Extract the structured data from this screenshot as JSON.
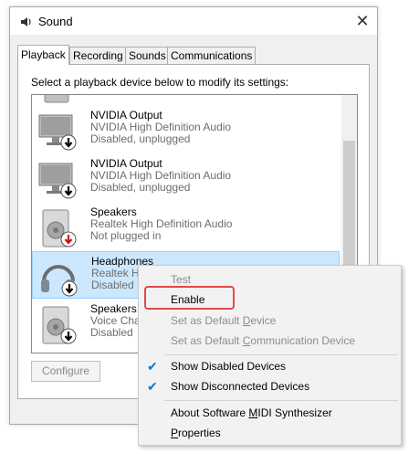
{
  "window": {
    "title": "Sound"
  },
  "tabs": [
    {
      "label": "Playback",
      "active": true
    },
    {
      "label": "Recording",
      "active": false
    },
    {
      "label": "Sounds",
      "active": false
    },
    {
      "label": "Communications",
      "active": false
    }
  ],
  "instruction": "Select a playback device below to modify its settings:",
  "devices": [
    {
      "name": "NVIDIA Output",
      "driver": "NVIDIA High Definition Audio",
      "status": "Disabled, unplugged",
      "icon": "monitor-icon"
    },
    {
      "name": "NVIDIA Output",
      "driver": "NVIDIA High Definition Audio",
      "status": "Disabled, unplugged",
      "icon": "monitor-icon"
    },
    {
      "name": "Speakers",
      "driver": "Realtek High Definition Audio",
      "status": "Not plugged in",
      "icon": "speaker-icon"
    },
    {
      "name": "Headphones",
      "driver": "Realtek Hi",
      "status": "Disabled",
      "icon": "headphones-icon"
    },
    {
      "name": "Speakers",
      "driver": "Voice Char",
      "status": "Disabled",
      "icon": "speaker-icon"
    }
  ],
  "configure_label": "Configure",
  "context_menu": {
    "test": "Test",
    "enable": "Enable",
    "set_default_pre": "Set as Default ",
    "set_default_ul": "D",
    "set_default_post": "evice",
    "set_comm_pre": "Set as Default ",
    "set_comm_ul": "C",
    "set_comm_post": "ommunication Device",
    "show_disabled": "Show Disabled Devices",
    "show_disconnected": "Show Disconnected Devices",
    "about_pre": "About Software ",
    "about_ul": "M",
    "about_post": "IDI Synthesizer",
    "properties_ul": "P",
    "properties_post": "roperties"
  },
  "colors": {
    "selection": "#cce8ff",
    "check": "#0078d7",
    "highlight_border": "#e04a4a"
  }
}
